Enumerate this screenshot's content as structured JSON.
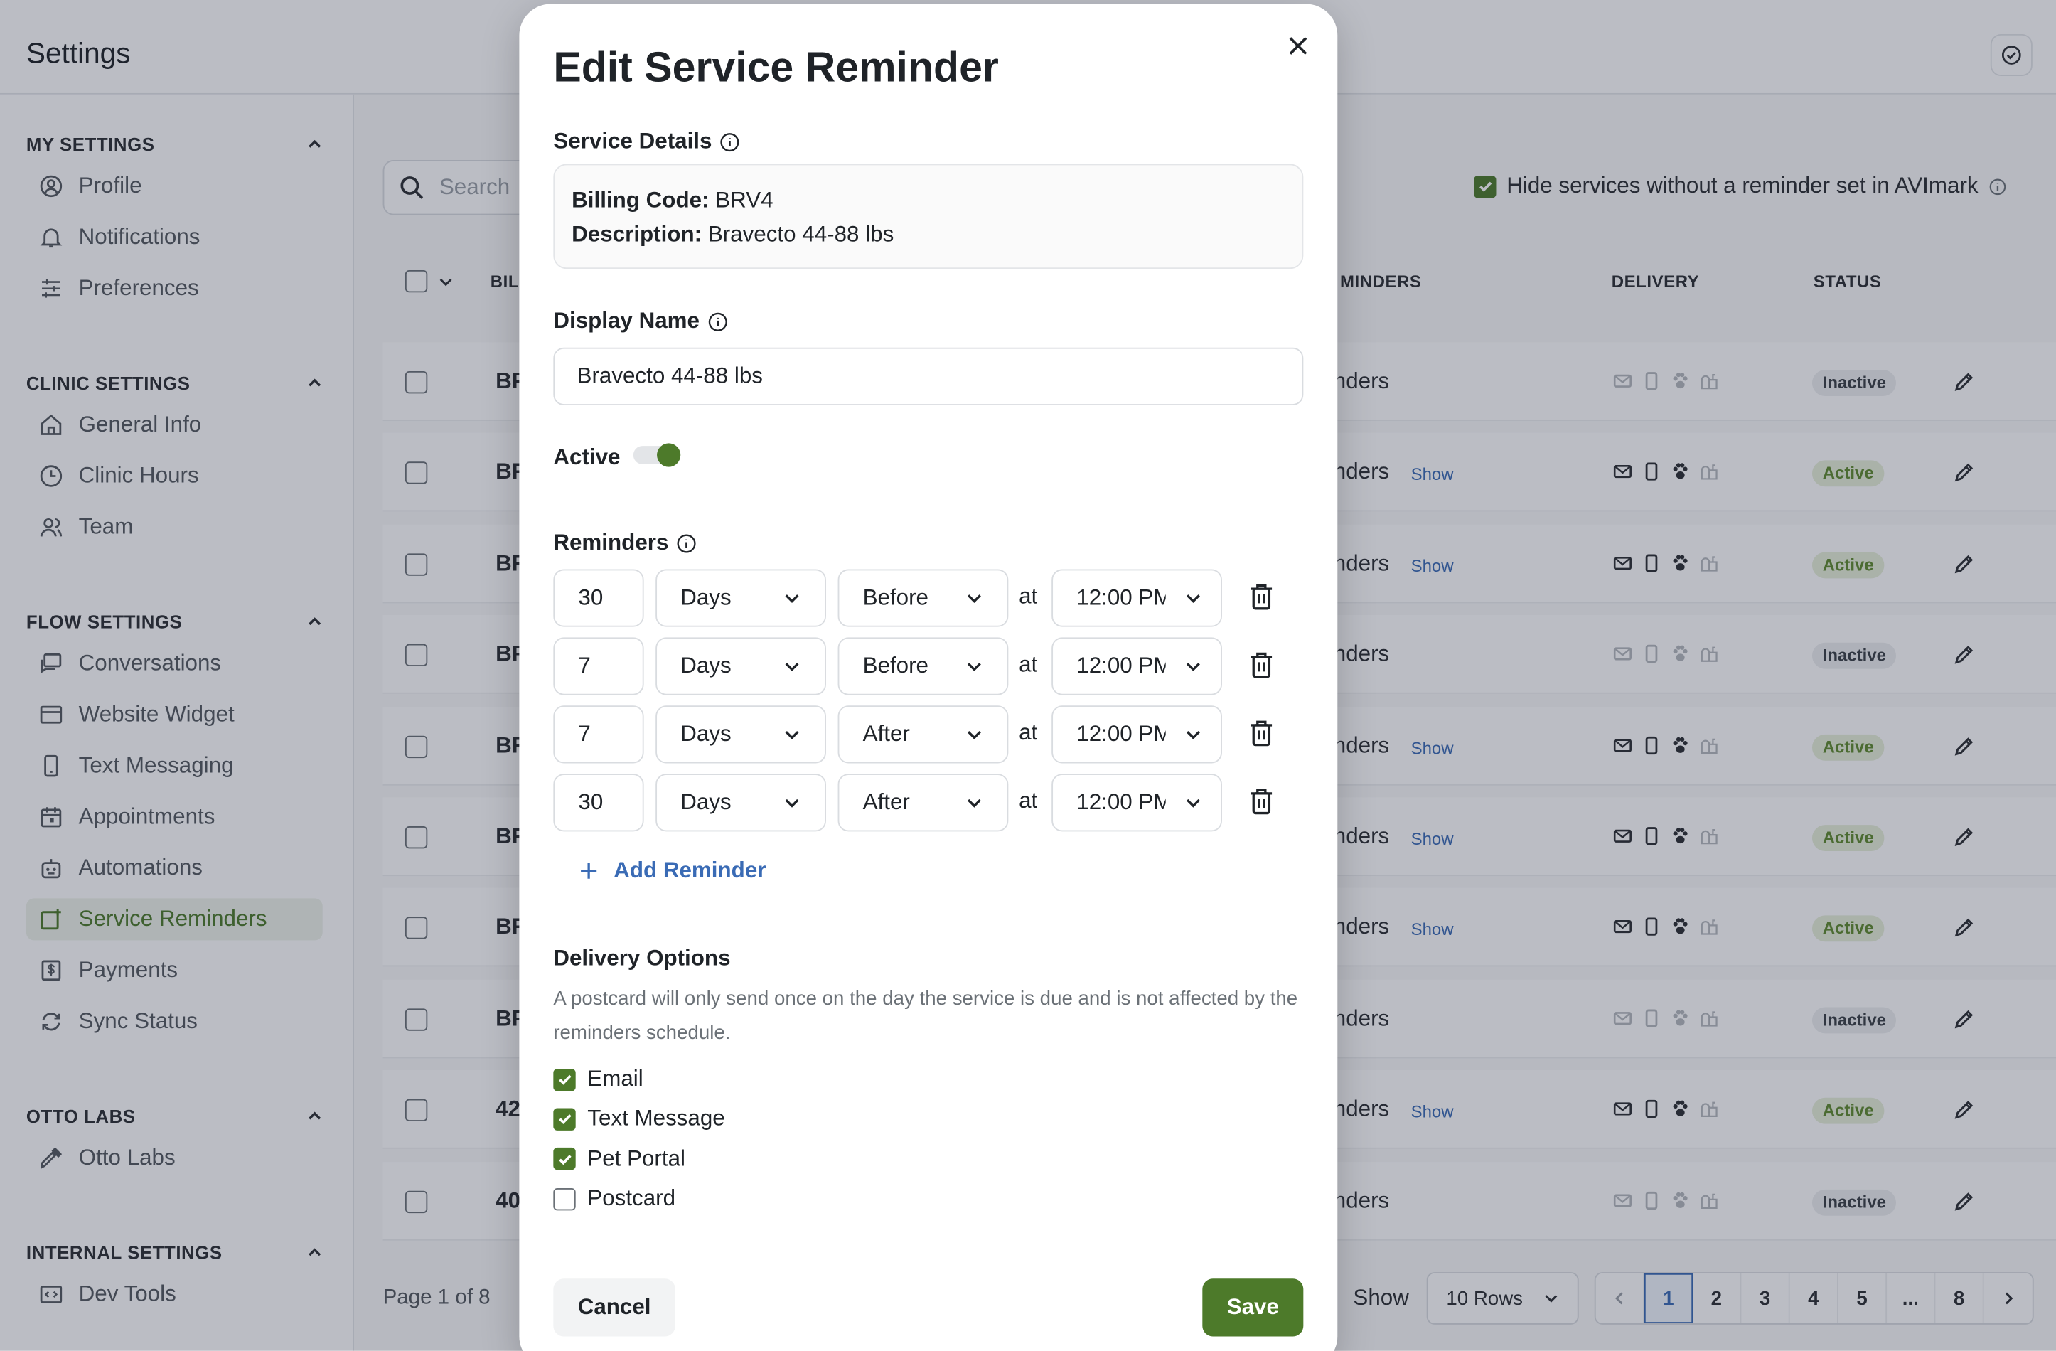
{
  "header": {
    "title": "Settings"
  },
  "sidebar": {
    "sections": [
      {
        "title": "MY SETTINGS",
        "items": [
          {
            "label": "Profile",
            "icon": "user-circle-icon"
          },
          {
            "label": "Notifications",
            "icon": "bell-icon"
          },
          {
            "label": "Preferences",
            "icon": "sliders-icon"
          }
        ]
      },
      {
        "title": "CLINIC SETTINGS",
        "items": [
          {
            "label": "General Info",
            "icon": "home-icon"
          },
          {
            "label": "Clinic Hours",
            "icon": "clock-icon"
          },
          {
            "label": "Team",
            "icon": "users-icon"
          }
        ]
      },
      {
        "title": "FLOW SETTINGS",
        "items": [
          {
            "label": "Conversations",
            "icon": "chat-icon"
          },
          {
            "label": "Website Widget",
            "icon": "window-icon"
          },
          {
            "label": "Text Messaging",
            "icon": "phone-icon"
          },
          {
            "label": "Appointments",
            "icon": "calendar-icon"
          },
          {
            "label": "Automations",
            "icon": "robot-icon"
          },
          {
            "label": "Service Reminders",
            "icon": "calendar-plus-icon",
            "active": true
          },
          {
            "label": "Payments",
            "icon": "dollar-icon"
          },
          {
            "label": "Sync Status",
            "icon": "sync-icon"
          }
        ]
      },
      {
        "title": "OTTO LABS",
        "items": [
          {
            "label": "Otto Labs",
            "icon": "pipette-icon"
          }
        ]
      },
      {
        "title": "INTERNAL SETTINGS",
        "items": [
          {
            "label": "Dev Tools",
            "icon": "code-window-icon"
          }
        ]
      }
    ]
  },
  "main": {
    "search_placeholder": "Search",
    "hide_services_label": "Hide services without a reminder set in AVImark",
    "columns": {
      "billing": "BILL",
      "reminders": "MINDERS",
      "delivery": "DELIVERY",
      "status": "STATUS"
    },
    "rows": [
      {
        "code": "BF",
        "reminders": "nders",
        "show": "",
        "status": "Inactive"
      },
      {
        "code": "BF",
        "reminders": "nders",
        "show": "Show",
        "status": "Active"
      },
      {
        "code": "BF",
        "reminders": "nders",
        "show": "Show",
        "status": "Active"
      },
      {
        "code": "BF",
        "reminders": "nders",
        "show": "",
        "status": "Inactive"
      },
      {
        "code": "BF",
        "reminders": "nders",
        "show": "Show",
        "status": "Active"
      },
      {
        "code": "BF",
        "reminders": "nders",
        "show": "Show",
        "status": "Active"
      },
      {
        "code": "BF",
        "reminders": "nders",
        "show": "Show",
        "status": "Active"
      },
      {
        "code": "BF",
        "reminders": "nders",
        "show": "",
        "status": "Inactive"
      },
      {
        "code": "42",
        "reminders": "nders",
        "show": "Show",
        "status": "Active"
      },
      {
        "code": "40",
        "reminders": "nders",
        "show": "",
        "status": "Inactive"
      }
    ],
    "footer": {
      "page_info": "Page 1 of 8",
      "show_label": "Show",
      "rows_select": "10 Rows",
      "pages": [
        "1",
        "2",
        "3",
        "4",
        "5",
        "...",
        "8"
      ],
      "current_page": "1"
    }
  },
  "modal": {
    "title": "Edit Service Reminder",
    "service_details_label": "Service Details",
    "billing_code_label": "Billing Code:",
    "billing_code_value": "BRV4",
    "description_label": "Description:",
    "description_value": "Bravecto 44-88 lbs",
    "display_name_label": "Display Name",
    "display_name_value": "Bravecto 44-88 lbs",
    "active_label": "Active",
    "active": true,
    "reminders_label": "Reminders",
    "reminders": [
      {
        "amount": "30",
        "unit": "Days",
        "relation": "Before",
        "at": "at",
        "time": "12:00 PM"
      },
      {
        "amount": "7",
        "unit": "Days",
        "relation": "Before",
        "at": "at",
        "time": "12:00 PM"
      },
      {
        "amount": "7",
        "unit": "Days",
        "relation": "After",
        "at": "at",
        "time": "12:00 PM"
      },
      {
        "amount": "30",
        "unit": "Days",
        "relation": "After",
        "at": "at",
        "time": "12:00 PM"
      }
    ],
    "add_reminder_label": "Add Reminder",
    "delivery_options_label": "Delivery Options",
    "delivery_note": "A postcard will only send once on the day the service is due and is not affected by the reminders schedule.",
    "delivery_options": [
      {
        "label": "Email",
        "checked": true
      },
      {
        "label": "Text Message",
        "checked": true
      },
      {
        "label": "Pet Portal",
        "checked": true
      },
      {
        "label": "Postcard",
        "checked": false
      }
    ],
    "cancel_label": "Cancel",
    "save_label": "Save"
  },
  "colors": {
    "accent": "#4d7a2a",
    "link": "#3a6bb5",
    "overlay": "#1e233c"
  }
}
